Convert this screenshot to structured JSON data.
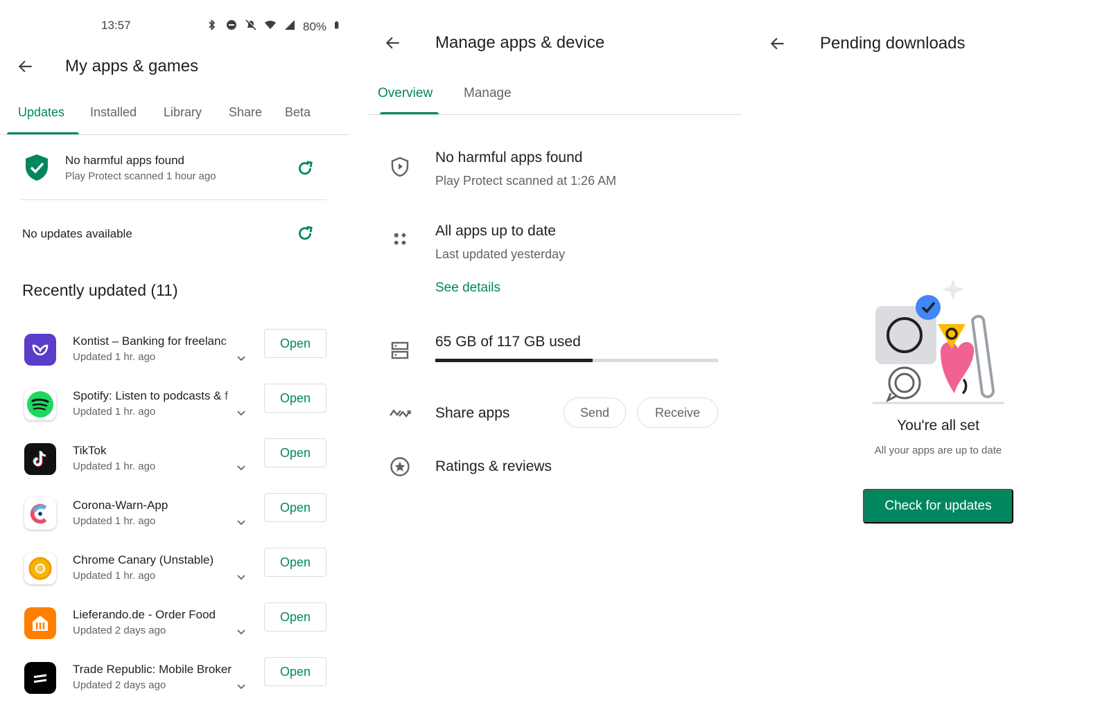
{
  "colors": {
    "accent": "#01875f",
    "text": "#202124",
    "secondary": "#5f6368",
    "divider": "#dadce0"
  },
  "status_bar": {
    "time": "13:57",
    "battery": "80%",
    "icons": [
      "bluetooth-icon",
      "dnd-icon",
      "mute-icon",
      "wifi-icon",
      "signal-icon",
      "battery-icon"
    ]
  },
  "my_apps": {
    "title": "My apps & games",
    "tabs": [
      {
        "label": "Updates",
        "active": true
      },
      {
        "label": "Installed",
        "active": false
      },
      {
        "label": "Library",
        "active": false
      },
      {
        "label": "Share",
        "active": false
      },
      {
        "label": "Beta",
        "active": false
      }
    ],
    "protect": {
      "title": "No harmful apps found",
      "subtitle": "Play Protect scanned 1 hour ago",
      "icon": "shield-check-icon"
    },
    "no_updates": "No updates available",
    "recent_heading": "Recently updated (11)",
    "apps": [
      {
        "name": "Kontist – Banking for freelanc",
        "updated": "Updated 1 hr. ago",
        "button": "Open",
        "icon": "kontist-icon",
        "color": "#5a3dc8"
      },
      {
        "name": "Spotify: Listen to podcasts & f",
        "updated": "Updated 1 hr. ago",
        "button": "Open",
        "icon": "spotify-icon",
        "color": "#1ed760"
      },
      {
        "name": "TikTok",
        "updated": "Updated 1 hr. ago",
        "button": "Open",
        "icon": "tiktok-icon",
        "color": "#111111"
      },
      {
        "name": "Corona-Warn-App",
        "updated": "Updated 1 hr. ago",
        "button": "Open",
        "icon": "corona-warn-icon",
        "color": "#e84c6c"
      },
      {
        "name": "Chrome Canary (Unstable)",
        "updated": "Updated 1 hr. ago",
        "button": "Open",
        "icon": "chrome-canary-icon",
        "color": "#f7b500"
      },
      {
        "name": "Lieferando.de - Order Food",
        "updated": "Updated 2 days ago",
        "button": "Open",
        "icon": "lieferando-icon",
        "color": "#ff8000"
      },
      {
        "name": "Trade Republic: Mobile Broker",
        "updated": "Updated 2 days ago",
        "button": "Open",
        "icon": "trade-republic-icon",
        "color": "#000000"
      }
    ]
  },
  "manage": {
    "title": "Manage apps & device",
    "tabs": [
      {
        "label": "Overview",
        "active": true
      },
      {
        "label": "Manage",
        "active": false
      }
    ],
    "protect": {
      "title": "No harmful apps found",
      "subtitle": "Play Protect scanned at 1:26 AM",
      "icon": "shield-outline-icon"
    },
    "updates": {
      "title": "All apps up to date",
      "subtitle": "Last updated yesterday",
      "link": "See details",
      "icon": "apps-grid-icon"
    },
    "storage": {
      "label": "65 GB of 117 GB used",
      "used_fraction": 0.556,
      "icon": "storage-icon"
    },
    "share": {
      "label": "Share apps",
      "send": "Send",
      "receive": "Receive",
      "icon": "share-apps-icon"
    },
    "ratings": {
      "label": "Ratings & reviews",
      "icon": "star-circle-icon"
    }
  },
  "pending": {
    "title": "Pending downloads",
    "heading": "You're all set",
    "subtitle": "All your apps are up to date",
    "button": "Check for updates",
    "illustration": "all-set-illustration"
  }
}
